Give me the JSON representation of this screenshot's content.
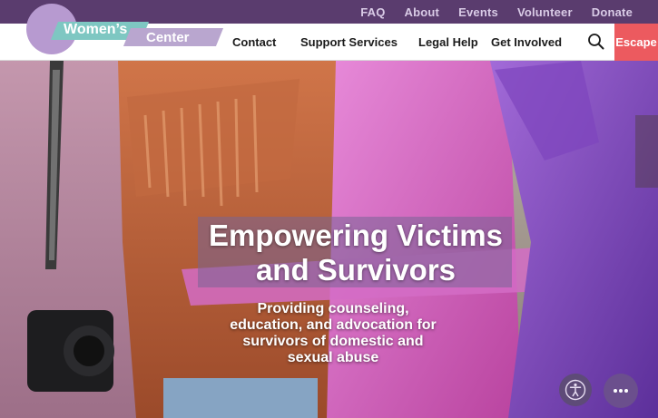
{
  "utility_nav": [
    "FAQ",
    "About",
    "Events",
    "Volunteer",
    "Donate"
  ],
  "logo": {
    "line1": "Women’s",
    "line2": "Center"
  },
  "main_nav": [
    "Contact",
    "Support Services",
    "Legal Help",
    "Get Involved"
  ],
  "escape_label": "Escape",
  "hero": {
    "title_line1": "Empowering Victims",
    "title_line2": "and Survivors",
    "subtitle": "Providing counseling, education, and advocation for survivors of domestic and sexual abuse"
  },
  "icons": {
    "search": "search-icon",
    "accessibility": "accessibility-icon",
    "chat": "chat-icon"
  },
  "colors": {
    "utility_bar": "#5a3c6e",
    "escape": "#ec5a5f",
    "logo_circle": "#b79ad0",
    "logo_teal": "#7ec7c2",
    "logo_lavender": "#b9a6cf"
  }
}
